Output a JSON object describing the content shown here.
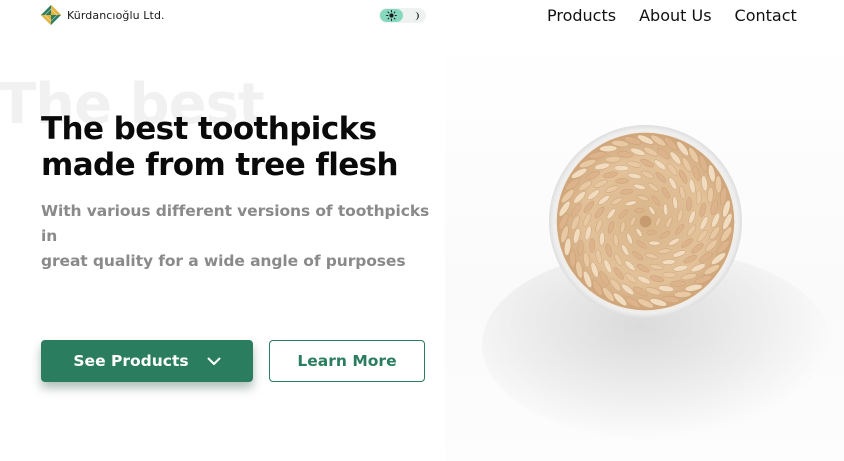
{
  "brand": {
    "name": "Kürdancıoğlu Ltd.",
    "logo_icon": "diamond-logo-icon"
  },
  "theme_toggle": {
    "light_icon": "sun-icon",
    "dark_icon": "moon-icon",
    "active": "light"
  },
  "nav": {
    "items": [
      "Products",
      "About Us",
      "Contact"
    ]
  },
  "hero": {
    "background_text": "The best",
    "title_line1": "The best toothpicks",
    "title_line2": "made from tree flesh",
    "subtitle_line1": "With various different versions of toothpicks in",
    "subtitle_line2": "great quality for a wide angle of purposes"
  },
  "buttons": {
    "primary_label": "See Products",
    "primary_icon": "chevron-down-icon",
    "secondary_label": "Learn More"
  },
  "colors": {
    "accent": "#2b7d5f",
    "logo_yellow": "#e8b33a",
    "logo_green": "#2b7d5f",
    "toggle_active": "#86d8be",
    "subtitle_gray": "#8a8a8a"
  },
  "product_image": {
    "subject": "toothpicks-in-glass-top-view"
  }
}
